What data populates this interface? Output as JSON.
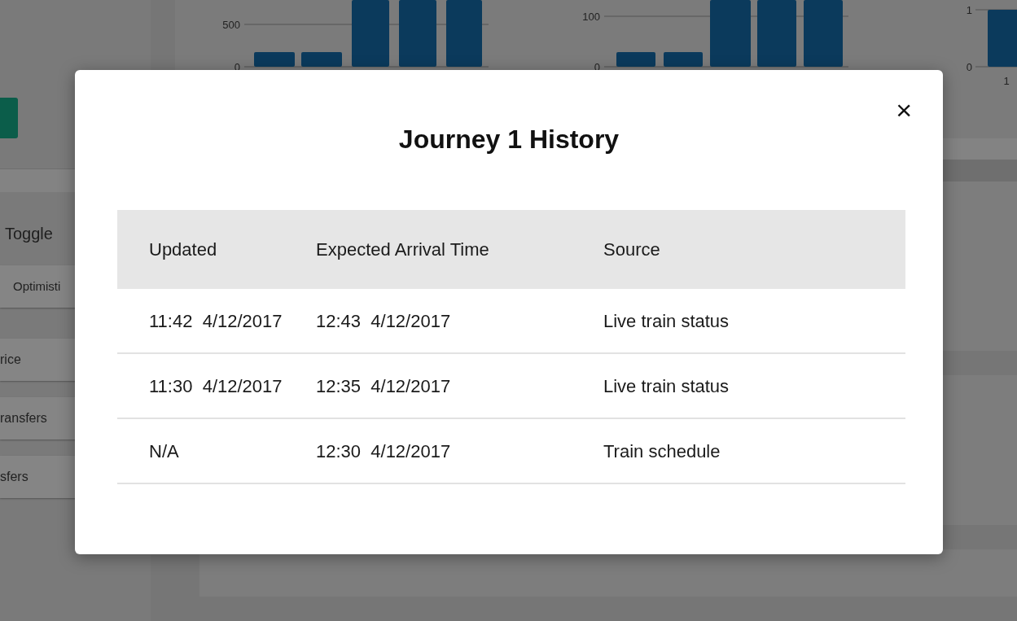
{
  "background": {
    "sidebar": {
      "label": "Toggle",
      "buttons": [
        "Optimisti",
        "rice",
        "ransfers",
        "sfers"
      ]
    },
    "charts": [
      {
        "ticks": [
          "500",
          "0"
        ]
      },
      {
        "ticks": [
          "100",
          "0"
        ]
      },
      {
        "ticks": [
          "1",
          "0"
        ],
        "x_labels": [
          "1"
        ]
      }
    ]
  },
  "modal": {
    "title": "Journey 1 History",
    "close": "×",
    "table": {
      "columns": [
        "Updated",
        "Expected Arrival Time",
        "Source"
      ],
      "rows": [
        [
          "11:42  4/12/2017",
          "12:43  4/12/2017",
          "Live train status"
        ],
        [
          "11:30  4/12/2017",
          "12:35  4/12/2017",
          "Live train status"
        ],
        [
          "N/A",
          "12:30  4/12/2017",
          "Train schedule"
        ]
      ]
    }
  }
}
